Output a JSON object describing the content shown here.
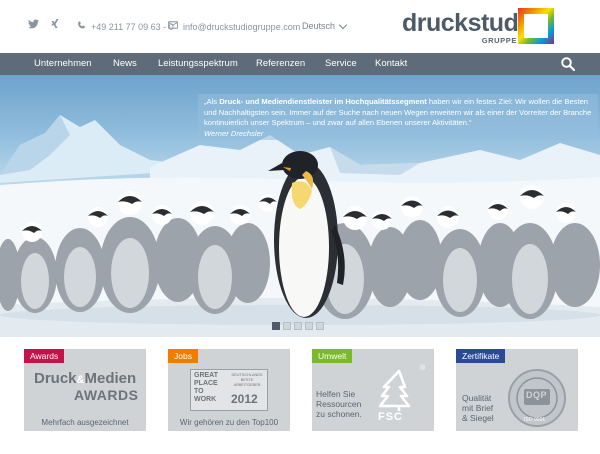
{
  "topbar": {
    "social": [
      {
        "name": "twitter-icon",
        "glyph": "🐦︎"
      },
      {
        "name": "xing-icon",
        "glyph": "✕"
      }
    ],
    "phone": "+49 211 77 09 63 - 0",
    "email": "info@druckstudiogruppe.com",
    "language": "Deutsch"
  },
  "logo": {
    "name": "druckstudio",
    "sub": "GRUPPE",
    "colors": [
      "#e8332a",
      "#f39200",
      "#ffde00",
      "#7ab929",
      "#009ee0",
      "#1d3a8f",
      "#8b2a87"
    ]
  },
  "nav": {
    "items": [
      "Unternehmen",
      "News",
      "Leistungsspektrum",
      "Referenzen",
      "Service",
      "Kontakt"
    ],
    "background": "#5e6b78"
  },
  "hero": {
    "quote_open": "„Als ",
    "quote_bold": "Druck- und Mediendienstleister im Hochqualitätssegment",
    "quote_rest": " haben wir ein festes Ziel: Wir wollen die Besten und Nachhaltigsten sein. Immer auf der Suche nach neuen Wegen erweitern wir als einer der Vorreiter der Branche kontinuierlich unser Spektrum – und zwar auf allen Ebenen unserer Aktivitäten.“",
    "author": "Werner Drechsler",
    "slides": 5,
    "active_slide": 0
  },
  "cards": [
    {
      "tag": "Awards",
      "tag_color": "#c4124b",
      "caption": "Mehrfach ausgezeichnet",
      "logo_line1": "Druck",
      "logo_amp": "&",
      "logo_line2": "Medien",
      "logo_line3": "AWARDS"
    },
    {
      "tag": "Jobs",
      "tag_color": "#f07d00",
      "caption": "Wir gehören zu den Top100",
      "gp_lines": [
        "GREAT",
        "PLACE",
        "TO",
        "WORK"
      ],
      "gp_small": [
        "DEUTSCHLANDS",
        "BESTE",
        "ARBEITGEBER"
      ],
      "gp_year": "2012"
    },
    {
      "tag": "Umwelt",
      "tag_color": "#7ab929",
      "text_lines": [
        "Helfen Sie",
        "Ressourcen",
        "zu schonen."
      ],
      "fsc": "FSC",
      "reg": "®"
    },
    {
      "tag": "Zertifikate",
      "tag_color": "#2b4a96",
      "text_lines": [
        "Qualität",
        "mit Brief",
        "& Siegel"
      ],
      "seal_text": "DQP",
      "seal_sub": "ISO 9001"
    }
  ]
}
